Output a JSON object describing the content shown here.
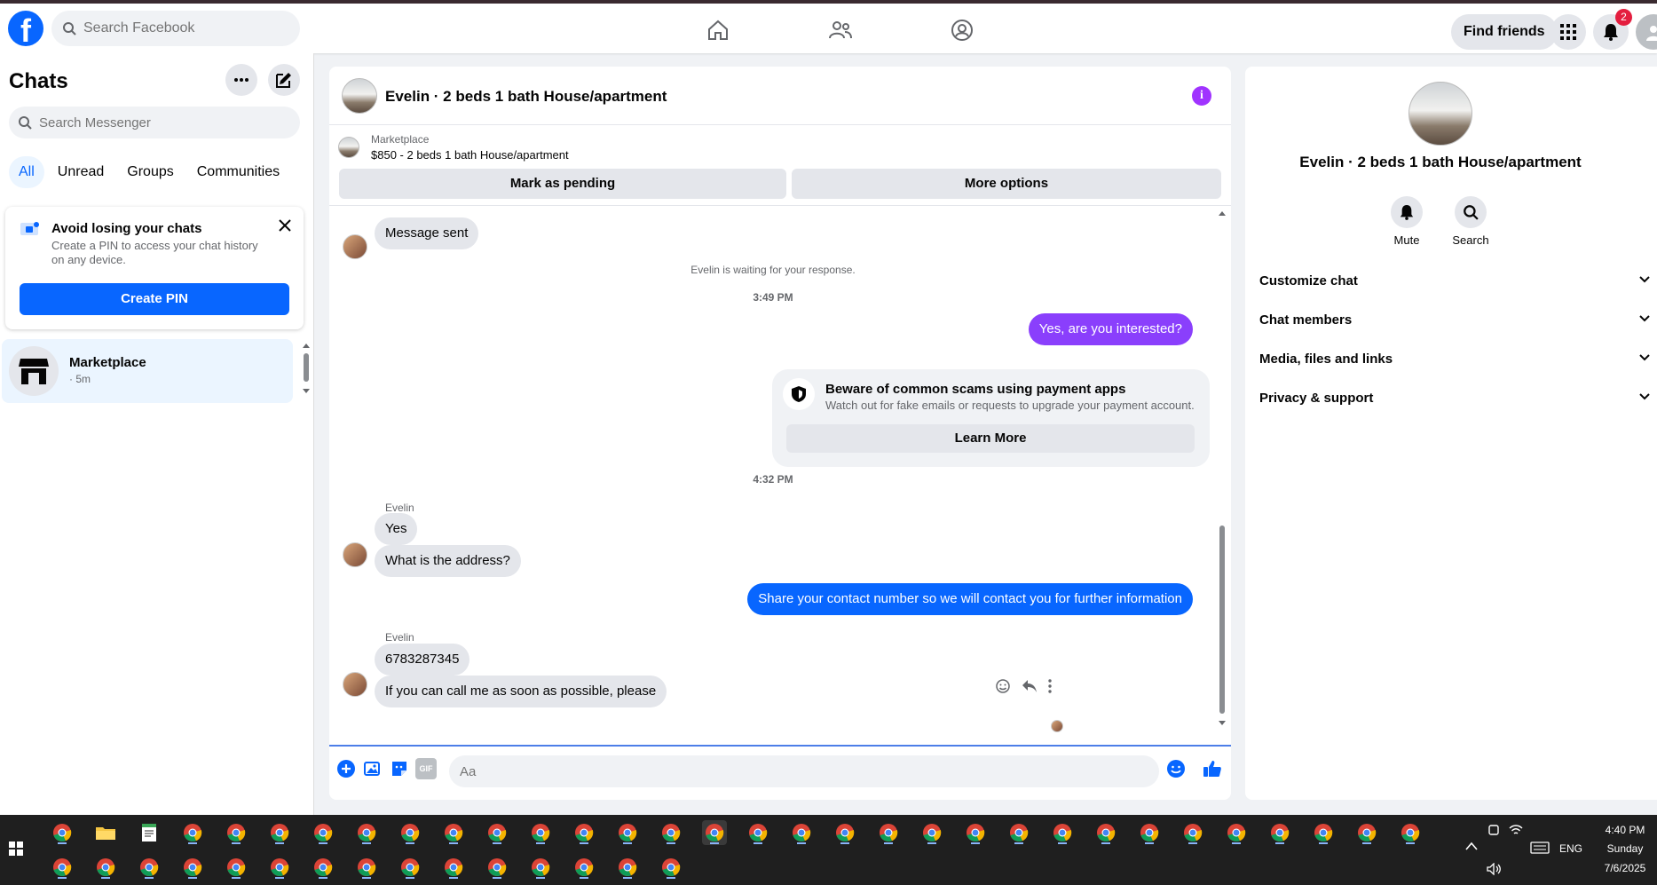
{
  "topbar": {
    "logo": "f",
    "search_placeholder": "Search Facebook",
    "find_friends": "Find friends",
    "notification_count": "2"
  },
  "sidebar": {
    "title": "Chats",
    "search_placeholder": "Search Messenger",
    "filters": [
      "All",
      "Unread",
      "Groups",
      "Communities"
    ],
    "pin_card": {
      "title": "Avoid losing your chats",
      "desc": "Create a PIN to access your chat history on any device.",
      "button": "Create PIN"
    },
    "chats": [
      {
        "name": "Marketplace",
        "time": "· 5m"
      }
    ]
  },
  "chat": {
    "title": "Evelin · 2 beds 1 bath House/apartment",
    "marketplace_label": "Marketplace",
    "listing": "$850 - 2 beds 1 bath House/apartment",
    "mark_pending": "Mark as pending",
    "more_options": "More options",
    "messages": {
      "m_sent": "Message sent",
      "waiting": "Evelin is waiting for your response.",
      "time1": "3:49 PM",
      "m_interested": "Yes, are you interested?",
      "time2": "4:32 PM",
      "sender": "Evelin",
      "m_yes": "Yes",
      "m_address": "What is the address?",
      "m_share": "Share your contact number so we will contact you for further information",
      "m_number": "6783287345",
      "m_call": "If you can call me as soon as possible, please"
    },
    "scam": {
      "title": "Beware of common scams using payment apps",
      "desc": "Watch out for fake emails or requests to upgrade your payment account.",
      "button": "Learn More"
    },
    "composer_placeholder": "Aa",
    "gif_label": "GIF"
  },
  "right_panel": {
    "title": "Evelin · 2 beds 1 bath House/apartment",
    "mute": "Mute",
    "search": "Search",
    "sections": [
      "Customize chat",
      "Chat members",
      "Media, files and links",
      "Privacy & support"
    ]
  },
  "taskbar": {
    "lang": "ENG",
    "time": "4:40 PM",
    "day": "Sunday",
    "date": "7/6/2025"
  },
  "colors": {
    "brand": "#0866ff",
    "purple": "#8a3ffc",
    "info": "#a033ff"
  }
}
